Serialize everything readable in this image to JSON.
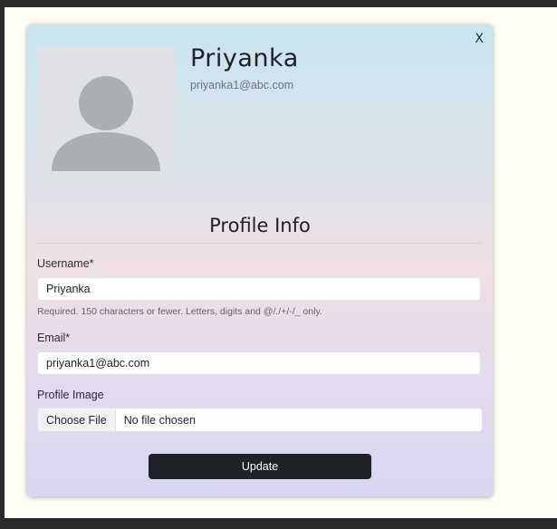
{
  "modal": {
    "close_label": "X"
  },
  "profile": {
    "name": "Priyanka",
    "email": "priyanka1@abc.com"
  },
  "form": {
    "section_title": "Profile Info",
    "username": {
      "label": "Username*",
      "value": "Priyanka",
      "help_text": "Required. 150 characters or fewer. Letters, digits and @/./+/-/_ only."
    },
    "email": {
      "label": "Email*",
      "value": "priyanka1@abc.com"
    },
    "profile_image": {
      "label": "Profile Image",
      "choose_label": "Choose File",
      "status": "No file chosen"
    },
    "submit_label": "Update"
  },
  "colors": {
    "button_bg": "#1f2227",
    "avatar_bg": "#e0e1e5",
    "avatar_silhouette": "#abafb3",
    "close_color": "#1b2a5c"
  },
  "icons": {
    "avatar": "user-silhouette-icon"
  }
}
